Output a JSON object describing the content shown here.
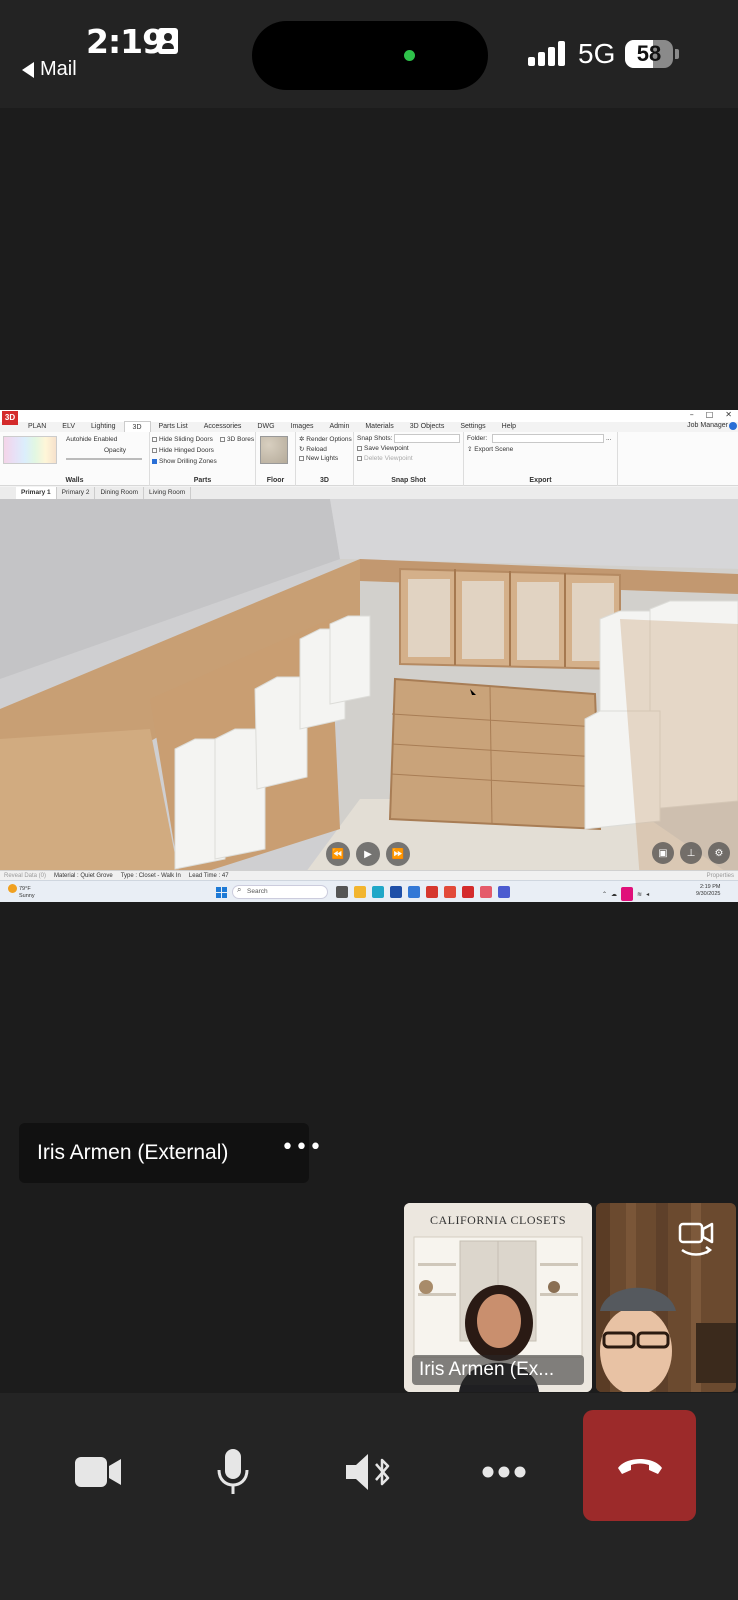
{
  "status_bar": {
    "time": "2:19",
    "back_label": "Mail",
    "network": "5G",
    "battery_percent": 58,
    "battery_label": "58"
  },
  "shared_screen": {
    "app_logo": "3D",
    "window_controls": [
      "–",
      "□",
      "✕"
    ],
    "menu": [
      "PLAN",
      "ELV",
      "Lighting",
      "3D",
      "Parts List",
      "Accessories",
      "DWG",
      "Images",
      "Admin",
      "Materials",
      "3D Objects",
      "Settings",
      "Help"
    ],
    "active_menu": "3D",
    "job_manager": "Job Manager",
    "ribbon": {
      "walls": {
        "title": "Walls",
        "autohide": "Autohide Enabled",
        "opacity": "Opacity"
      },
      "parts": {
        "title": "Parts",
        "hide_sliding": "Hide Sliding Doors",
        "hide_hinged": "Hide Hinged Doors",
        "show_drilling": "Show Drilling Zones",
        "bores": "3D Bores"
      },
      "floor": {
        "title": "Floor"
      },
      "three_d": {
        "title": "3D",
        "render_options": "Render Options",
        "reload": "Reload",
        "new_lights": "New Lights"
      },
      "snap_shot": {
        "title": "Snap Shot",
        "snap_shots": "Snap Shots:",
        "save_viewpoint": "Save Viewpoint",
        "delete_viewpoint": "Delete Viewpoint"
      },
      "export": {
        "title": "Export",
        "folder": "Folder:",
        "export_scene": "Export Scene",
        "browse": "..."
      }
    },
    "tabs": [
      "Primary 1",
      "Primary 2",
      "Dining Room",
      "Living Room"
    ],
    "active_tab": "Primary 1",
    "playback": {
      "rewind": "⏪",
      "play": "▶",
      "forward": "⏩"
    },
    "status_line": {
      "left_muted": "Reveal Data (0)",
      "material": "Material : Quiet Grove",
      "type": "Type : Closet - Walk In",
      "lead_time": "Lead Time : 47",
      "right_muted": "Properties"
    },
    "taskbar": {
      "weather_temp": "79°F",
      "weather_desc": "Sunny",
      "search": "Search",
      "clock_time": "2:19 PM",
      "clock_date": "9/30/2025"
    }
  },
  "participant_card": {
    "name": "Iris Armen (External)",
    "more_label": "•••"
  },
  "tiles": {
    "iris_brand": "CALIFORNIA CLOSETS",
    "iris_name": "Iris Armen (Ex..."
  },
  "colors": {
    "background": "#1c1c1c",
    "end_call": "#9c2a2a",
    "active_dot": "#2ec24a"
  },
  "icons": {
    "video": "video-camera-icon",
    "mic": "microphone-icon",
    "speaker": "speaker-bluetooth-icon",
    "more": "more-icon",
    "end": "hang-up-icon",
    "switch_camera": "switch-camera-icon"
  }
}
